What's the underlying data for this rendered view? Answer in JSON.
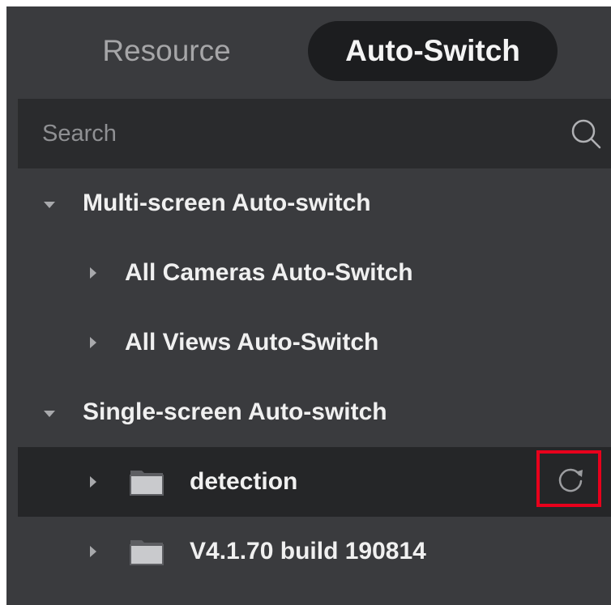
{
  "tabs": {
    "resource_label": "Resource",
    "autoswitch_label": "Auto-Switch",
    "active": "Auto-Switch"
  },
  "search": {
    "placeholder": "Search",
    "value": ""
  },
  "tree": {
    "groups": [
      {
        "label": "Multi-screen Auto-switch",
        "expanded": true,
        "items": [
          {
            "label": "All Cameras Auto-Switch",
            "icon": "none",
            "expanded": false
          },
          {
            "label": "All Views Auto-Switch",
            "icon": "none",
            "expanded": false
          }
        ]
      },
      {
        "label": "Single-screen Auto-switch",
        "expanded": true,
        "items": [
          {
            "label": "detection",
            "icon": "folder-icon",
            "expanded": false,
            "selected": true,
            "action_icon": "refresh-icon"
          },
          {
            "label": "V4.1.70 build 190814",
            "icon": "folder-icon",
            "expanded": false
          }
        ]
      }
    ]
  },
  "colors": {
    "panel_bg": "#3a3b3e",
    "search_bg": "#2a2b2d",
    "active_tab_bg": "#1c1d1f",
    "selected_row_bg": "#252628",
    "highlight_border": "#e8001c"
  }
}
